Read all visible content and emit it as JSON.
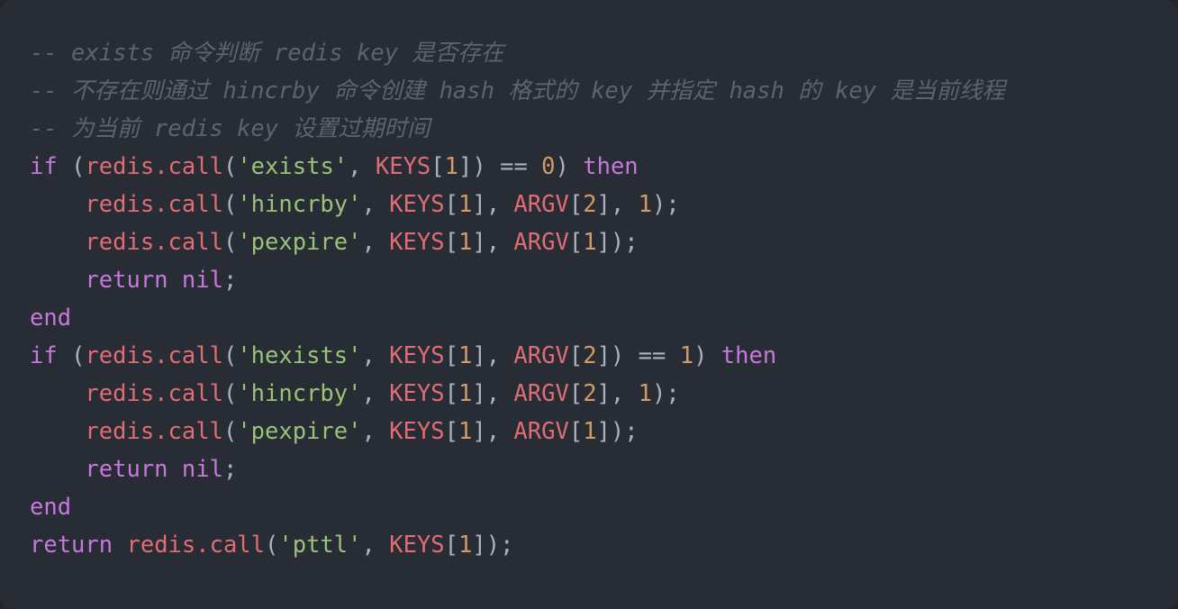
{
  "editor": {
    "language": "lua",
    "theme": "one-dark",
    "background_color": "#282c34",
    "page_background_color": "#22252c",
    "colors": {
      "comment": "#5c6370",
      "keyword": "#c678dd",
      "function": "#e06c75",
      "variable": "#e06c75",
      "string": "#98c379",
      "number": "#d19a66",
      "punctuation": "#abb2bf",
      "operator": "#abb2bf"
    }
  },
  "code": {
    "lines": [
      {
        "index": 1,
        "indent": 0,
        "text": "-- exists 命令判断 redis key 是否存在",
        "tokens": [
          {
            "t": "-- exists 命令判断 redis key 是否存在",
            "c": "cm"
          }
        ]
      },
      {
        "index": 2,
        "indent": 0,
        "text": "-- 不存在则通过 hincrby 命令创建 hash 格式的 key 并指定 hash 的 key 是当前线程",
        "tokens": [
          {
            "t": "-- 不存在则通过 hincrby 命令创建 hash 格式的 key 并指定 hash 的 key 是当前线程",
            "c": "cm"
          }
        ]
      },
      {
        "index": 3,
        "indent": 0,
        "text": "-- 为当前 redis key 设置过期时间",
        "tokens": [
          {
            "t": "-- 为当前 redis key 设置过期时间",
            "c": "cm"
          }
        ]
      },
      {
        "index": 4,
        "indent": 0,
        "text": "if (redis.call('exists', KEYS[1]) == 0) then",
        "tokens": [
          {
            "t": "if",
            "c": "kw"
          },
          {
            "t": " ",
            "c": "pun"
          },
          {
            "t": "(",
            "c": "pun"
          },
          {
            "t": "redis.call",
            "c": "fn"
          },
          {
            "t": "(",
            "c": "pun"
          },
          {
            "t": "'exists'",
            "c": "str"
          },
          {
            "t": ", ",
            "c": "pun"
          },
          {
            "t": "KEYS",
            "c": "var"
          },
          {
            "t": "[",
            "c": "pun"
          },
          {
            "t": "1",
            "c": "num"
          },
          {
            "t": "])",
            "c": "pun"
          },
          {
            "t": " ",
            "c": "pun"
          },
          {
            "t": "==",
            "c": "op"
          },
          {
            "t": " ",
            "c": "pun"
          },
          {
            "t": "0",
            "c": "num"
          },
          {
            "t": ")",
            "c": "pun"
          },
          {
            "t": " ",
            "c": "pun"
          },
          {
            "t": "then",
            "c": "kw"
          }
        ]
      },
      {
        "index": 5,
        "indent": 4,
        "text": "    redis.call('hincrby', KEYS[1], ARGV[2], 1);",
        "tokens": [
          {
            "t": "redis.call",
            "c": "fn"
          },
          {
            "t": "(",
            "c": "pun"
          },
          {
            "t": "'hincrby'",
            "c": "str"
          },
          {
            "t": ", ",
            "c": "pun"
          },
          {
            "t": "KEYS",
            "c": "var"
          },
          {
            "t": "[",
            "c": "pun"
          },
          {
            "t": "1",
            "c": "num"
          },
          {
            "t": "], ",
            "c": "pun"
          },
          {
            "t": "ARGV",
            "c": "var"
          },
          {
            "t": "[",
            "c": "pun"
          },
          {
            "t": "2",
            "c": "num"
          },
          {
            "t": "], ",
            "c": "pun"
          },
          {
            "t": "1",
            "c": "num"
          },
          {
            "t": ");",
            "c": "pun"
          }
        ]
      },
      {
        "index": 6,
        "indent": 4,
        "text": "    redis.call('pexpire', KEYS[1], ARGV[1]);",
        "tokens": [
          {
            "t": "redis.call",
            "c": "fn"
          },
          {
            "t": "(",
            "c": "pun"
          },
          {
            "t": "'pexpire'",
            "c": "str"
          },
          {
            "t": ", ",
            "c": "pun"
          },
          {
            "t": "KEYS",
            "c": "var"
          },
          {
            "t": "[",
            "c": "pun"
          },
          {
            "t": "1",
            "c": "num"
          },
          {
            "t": "], ",
            "c": "pun"
          },
          {
            "t": "ARGV",
            "c": "var"
          },
          {
            "t": "[",
            "c": "pun"
          },
          {
            "t": "1",
            "c": "num"
          },
          {
            "t": "]);",
            "c": "pun"
          }
        ]
      },
      {
        "index": 7,
        "indent": 4,
        "text": "    return nil;",
        "tokens": [
          {
            "t": "return",
            "c": "kw"
          },
          {
            "t": " ",
            "c": "pun"
          },
          {
            "t": "nil",
            "c": "kw"
          },
          {
            "t": ";",
            "c": "pun"
          }
        ]
      },
      {
        "index": 8,
        "indent": 0,
        "text": "end",
        "tokens": [
          {
            "t": "end",
            "c": "kw"
          }
        ]
      },
      {
        "index": 9,
        "indent": 0,
        "text": "if (redis.call('hexists', KEYS[1], ARGV[2]) == 1) then",
        "tokens": [
          {
            "t": "if",
            "c": "kw"
          },
          {
            "t": " ",
            "c": "pun"
          },
          {
            "t": "(",
            "c": "pun"
          },
          {
            "t": "redis.call",
            "c": "fn"
          },
          {
            "t": "(",
            "c": "pun"
          },
          {
            "t": "'hexists'",
            "c": "str"
          },
          {
            "t": ", ",
            "c": "pun"
          },
          {
            "t": "KEYS",
            "c": "var"
          },
          {
            "t": "[",
            "c": "pun"
          },
          {
            "t": "1",
            "c": "num"
          },
          {
            "t": "], ",
            "c": "pun"
          },
          {
            "t": "ARGV",
            "c": "var"
          },
          {
            "t": "[",
            "c": "pun"
          },
          {
            "t": "2",
            "c": "num"
          },
          {
            "t": "])",
            "c": "pun"
          },
          {
            "t": " ",
            "c": "pun"
          },
          {
            "t": "==",
            "c": "op"
          },
          {
            "t": " ",
            "c": "pun"
          },
          {
            "t": "1",
            "c": "num"
          },
          {
            "t": ")",
            "c": "pun"
          },
          {
            "t": " ",
            "c": "pun"
          },
          {
            "t": "then",
            "c": "kw"
          }
        ]
      },
      {
        "index": 10,
        "indent": 4,
        "text": "    redis.call('hincrby', KEYS[1], ARGV[2], 1);",
        "tokens": [
          {
            "t": "redis.call",
            "c": "fn"
          },
          {
            "t": "(",
            "c": "pun"
          },
          {
            "t": "'hincrby'",
            "c": "str"
          },
          {
            "t": ", ",
            "c": "pun"
          },
          {
            "t": "KEYS",
            "c": "var"
          },
          {
            "t": "[",
            "c": "pun"
          },
          {
            "t": "1",
            "c": "num"
          },
          {
            "t": "], ",
            "c": "pun"
          },
          {
            "t": "ARGV",
            "c": "var"
          },
          {
            "t": "[",
            "c": "pun"
          },
          {
            "t": "2",
            "c": "num"
          },
          {
            "t": "], ",
            "c": "pun"
          },
          {
            "t": "1",
            "c": "num"
          },
          {
            "t": ");",
            "c": "pun"
          }
        ]
      },
      {
        "index": 11,
        "indent": 4,
        "text": "    redis.call('pexpire', KEYS[1], ARGV[1]);",
        "tokens": [
          {
            "t": "redis.call",
            "c": "fn"
          },
          {
            "t": "(",
            "c": "pun"
          },
          {
            "t": "'pexpire'",
            "c": "str"
          },
          {
            "t": ", ",
            "c": "pun"
          },
          {
            "t": "KEYS",
            "c": "var"
          },
          {
            "t": "[",
            "c": "pun"
          },
          {
            "t": "1",
            "c": "num"
          },
          {
            "t": "], ",
            "c": "pun"
          },
          {
            "t": "ARGV",
            "c": "var"
          },
          {
            "t": "[",
            "c": "pun"
          },
          {
            "t": "1",
            "c": "num"
          },
          {
            "t": "]);",
            "c": "pun"
          }
        ]
      },
      {
        "index": 12,
        "indent": 4,
        "text": "    return nil;",
        "tokens": [
          {
            "t": "return",
            "c": "kw"
          },
          {
            "t": " ",
            "c": "pun"
          },
          {
            "t": "nil",
            "c": "kw"
          },
          {
            "t": ";",
            "c": "pun"
          }
        ]
      },
      {
        "index": 13,
        "indent": 0,
        "text": "end",
        "tokens": [
          {
            "t": "end",
            "c": "kw"
          }
        ]
      },
      {
        "index": 14,
        "indent": 0,
        "text": "return redis.call('pttl', KEYS[1]);",
        "tokens": [
          {
            "t": "return",
            "c": "kw"
          },
          {
            "t": " ",
            "c": "pun"
          },
          {
            "t": "redis.call",
            "c": "fn"
          },
          {
            "t": "(",
            "c": "pun"
          },
          {
            "t": "'pttl'",
            "c": "str"
          },
          {
            "t": ", ",
            "c": "pun"
          },
          {
            "t": "KEYS",
            "c": "var"
          },
          {
            "t": "[",
            "c": "pun"
          },
          {
            "t": "1",
            "c": "num"
          },
          {
            "t": "]);",
            "c": "pun"
          }
        ]
      }
    ]
  }
}
